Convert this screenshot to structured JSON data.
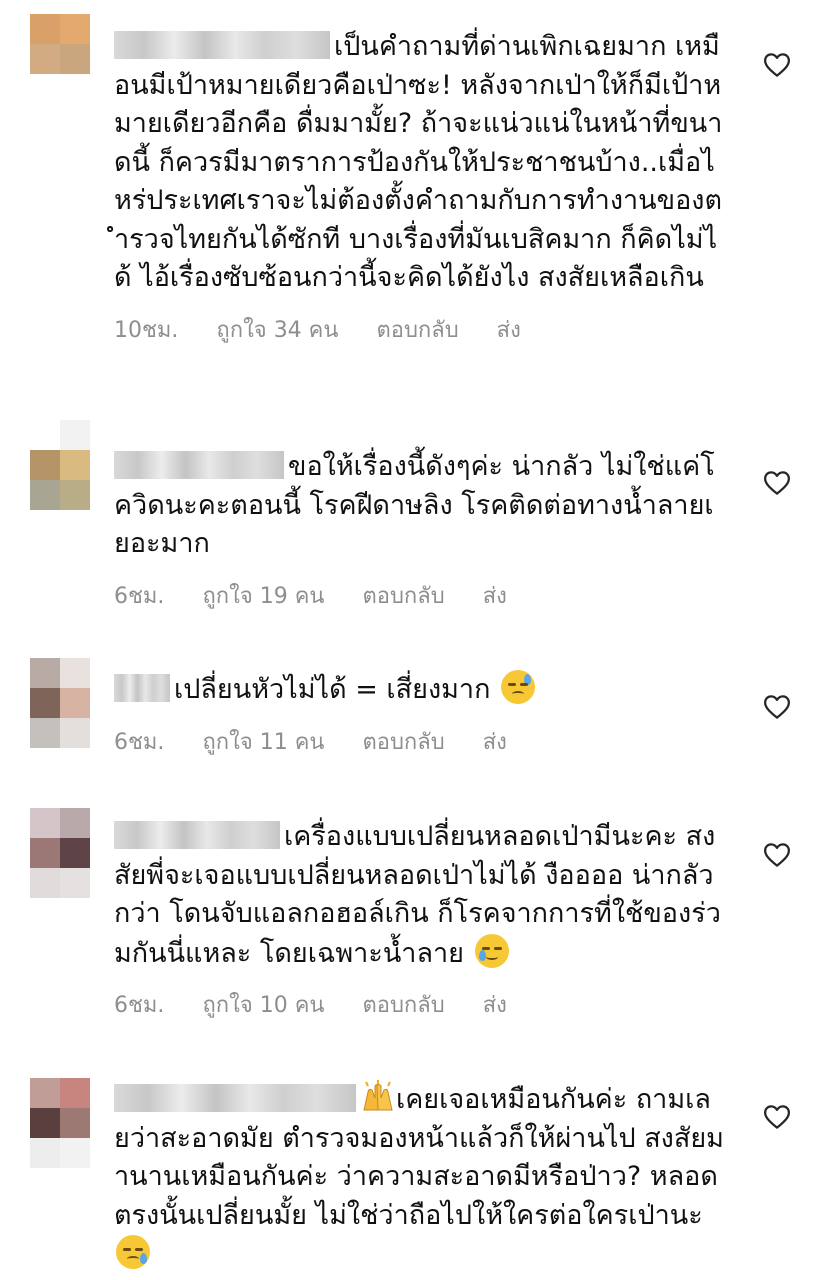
{
  "comments": [
    {
      "text": "เป็นคำถามที่ด่านเพิกเฉยมาก เหมือนมีเป้าหมายเดียวคือเป่าซะ! หลังจากเป่าให้ก็มีเป้าหมายเดียวอีกคือ ดื่มมามั้ย? ถ้าจะแน่วแน่ในหน้าที่ขนาดนี้ ก็ควรมีมาตราการป้องกันให้ประชาชนบ้าง..เมื่อไหร่ประเทศเราจะไม่ต้องตั้งคำถามกับการทำงานของตำรวจไทยกันได้ซักที บางเรื่องที่มันเบสิคมาก ก็คิดไม่ได้ ไอ้เรื่องซับซ้อนกว่านี้จะคิดได้ยังไง สงสัยเหลือเกิน",
      "time": "10ชม.",
      "likes": "ถูกใจ 34 คน",
      "reply": "ตอบกลับ",
      "send": "ส่ง"
    },
    {
      "text": "ขอให้เรื่องนี้ดังๆค่ะ น่ากลัว ไม่ใช่แค่โควิดนะคะตอนนี้ โรคฝีดาษลิง โรคติดต่อทางน้ำลายเยอะมาก",
      "time": "6ชม.",
      "likes": "ถูกใจ 19 คน",
      "reply": "ตอบกลับ",
      "send": "ส่ง"
    },
    {
      "text": "เปลี่ยนหัวไม่ได้ = เสี่ยงมาก",
      "emoji": "downcast-face-with-sweat",
      "time": "6ชม.",
      "likes": "ถูกใจ 11 คน",
      "reply": "ตอบกลับ",
      "send": "ส่ง"
    },
    {
      "text": "เครื่องแบบเปลี่ยนหลอดเป่ามีนะคะ สงสัยพี่จะเจอแบบเปลี่ยนหลอดเป่าไม่ได้ งืออออ น่ากลัวกว่า โดนจับแอลกอฮอล์เกิน ก็โรคจากการที่ใช้ของร่วมกันนี่แหละ โดยเฉพาะน้ำลาย",
      "emoji": "crying-face",
      "time": "6ชม.",
      "likes": "ถูกใจ 10 คน",
      "reply": "ตอบกลับ",
      "send": "ส่ง"
    },
    {
      "lead_emoji": "raising-hands",
      "text": "เคยเจอเหมือนกันค่ะ  ถามเลยว่าสะอาดมัย ตำรวจมองหน้าแล้วก็ให้ผ่านไป สงสัยมานานเหมือนกันค่ะ ว่าความสะอาดมีหรือป่าว? หลอดตรงนั้นเปลี่ยนมั้ย ไม่ใช่ว่าถือไปให้ใครต่อใครเป่านะ",
      "emoji": "face-holding-back-tears"
    }
  ],
  "colors": {
    "text": "#111111",
    "meta": "#8e8e8e",
    "heart_stroke": "#262626"
  },
  "icons": {
    "like": "heart-outline-icon"
  }
}
